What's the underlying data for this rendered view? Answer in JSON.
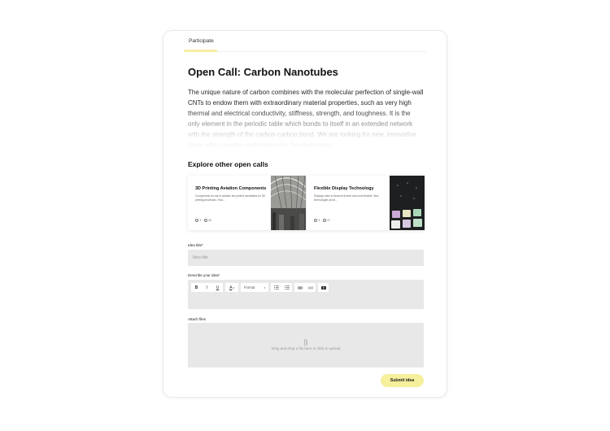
{
  "tabs": {
    "participate": "Participate"
  },
  "page": {
    "title": "Open Call: Carbon Nanotubes",
    "description": "The unique nature of carbon combines with the molecular perfection of single-wall CNTs to endow them with extraordinary material properties, such as very high thermal and electrical conductivity, stiffness, strength, and toughness. It is the only element in the periodic table which bonds to itself in an extended network with the strength of the carbon-carbon bond. We are looking for new, innovative ideas with possible applications for this technology."
  },
  "explore": {
    "heading": "Explore other open calls",
    "cards": [
      {
        "title": "3D Printing Aviation Components",
        "description": "Components for use in aviation are perfect candidates for 3D printing processes. How...",
        "comments": "2",
        "likes": "22"
      },
      {
        "title": "Flexible Display Technology",
        "description": "Displays have to become thinner and more flexible. New technologies proof...",
        "comments": "1",
        "likes": "17"
      }
    ]
  },
  "form": {
    "idea_title_label": "Idea title*",
    "idea_title_placeholder": "Idea title",
    "describe_label": "Describe your idea*",
    "toolbar": {
      "bold": "B",
      "italic": "I",
      "underline": "U",
      "text_color": "A",
      "format": "Format"
    },
    "attach_label": "Attach files",
    "upload_text": "Drag and drop a file here or click to upload",
    "submit": "Submit idea"
  },
  "colors": {
    "accent": "#f6ef9c",
    "field": "#e8e8e8"
  }
}
